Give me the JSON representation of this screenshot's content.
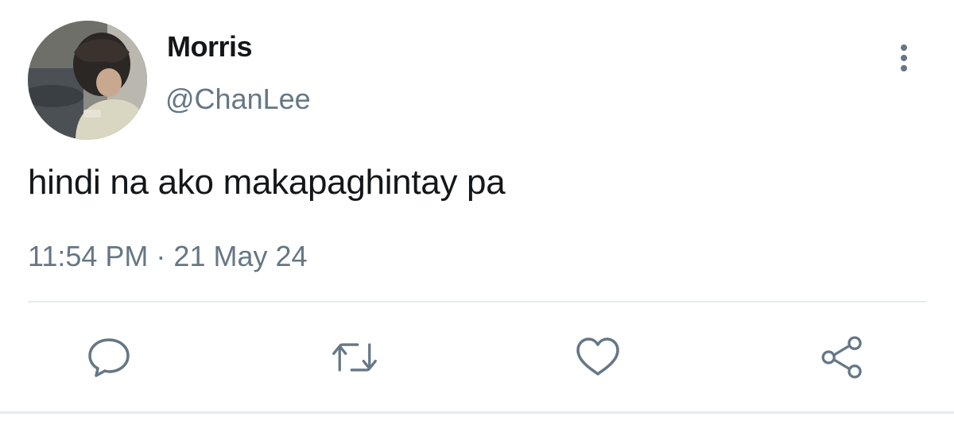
{
  "tweet": {
    "author": {
      "display_name": "Morris",
      "handle": "@ChanLee",
      "avatar_icon": "profile-photo"
    },
    "text": "hindi na ako makapaghintay pa",
    "time": "11:54 PM",
    "separator": " · ",
    "date": "21 May 24",
    "actions": {
      "reply_icon": "speech-bubble-icon",
      "retweet_icon": "retweet-arrows-icon",
      "like_icon": "heart-icon",
      "share_icon": "share-nodes-icon",
      "more_icon": "vertical-dots-icon"
    }
  },
  "colors": {
    "primary_text": "#14171a",
    "secondary_text": "#657786",
    "divider": "#e6ecf0"
  }
}
